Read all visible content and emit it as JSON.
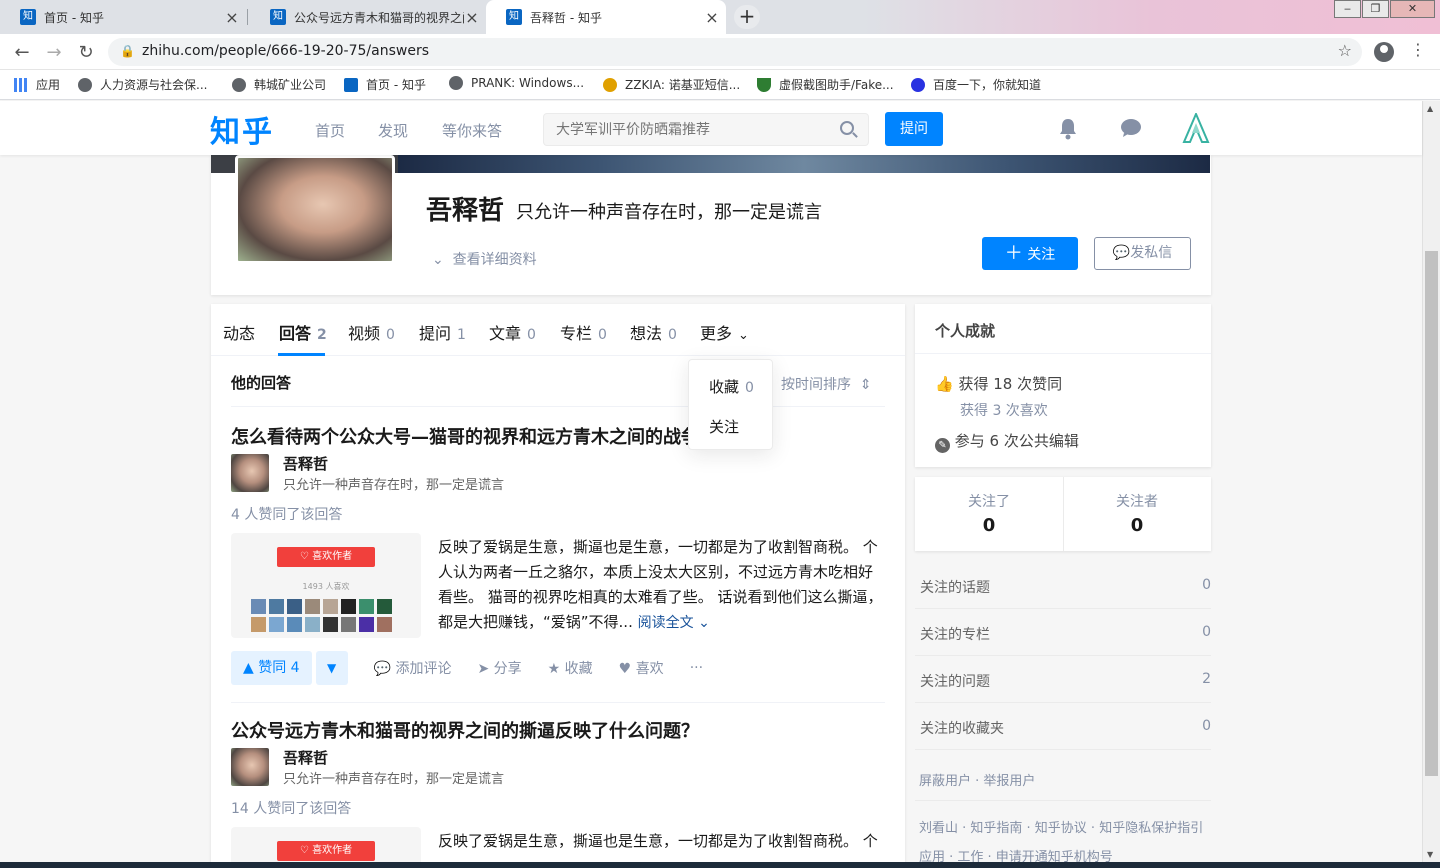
{
  "browser": {
    "tabs": [
      {
        "title": "首页 - 知乎",
        "favicon": "知"
      },
      {
        "title": "公众号远方青木和猫哥的视界之间",
        "favicon": "知"
      },
      {
        "title": "吾释哲 - 知乎",
        "favicon": "知"
      }
    ],
    "new_tab": "+",
    "close": "×",
    "url": "zhihu.com/people/666-19-20-75/answers",
    "window_controls": [
      "‒",
      "❐",
      "✕"
    ],
    "bookmarks": [
      {
        "label": "应用",
        "icon": "apps-grid-icon",
        "color": "#4285f4"
      },
      {
        "label": "人力资源与社会保...",
        "icon": "globe-icon",
        "color": "#5f6368"
      },
      {
        "label": "韩城矿业公司",
        "icon": "globe-icon",
        "color": "#5f6368"
      },
      {
        "label": "首页 - 知乎",
        "icon": "zhihu-icon",
        "color": "#0a66c2"
      },
      {
        "label": "PRANK: Windows...",
        "icon": "globe-icon",
        "color": "#5f6368"
      },
      {
        "label": "ZZKIA: 诺基亚短信...",
        "icon": "zzkia-icon",
        "color": "#e0a000"
      },
      {
        "label": "虚假截图助手/Fake...",
        "icon": "v-icon",
        "color": "#2e7d32"
      },
      {
        "label": "百度一下，你就知道",
        "icon": "baidu-icon",
        "color": "#2932e1"
      }
    ]
  },
  "header": {
    "logo": "知乎",
    "nav": [
      "首页",
      "发现",
      "等你来答"
    ],
    "search_placeholder": "大学军训平价防晒霜推荐",
    "ask_label": "提问"
  },
  "profile": {
    "name": "吾释哲",
    "headline": "只允许一种声音存在时，那一定是谎言",
    "detail_label": "查看详细资料",
    "follow_label": "关注",
    "message_label": "发私信"
  },
  "tabs": [
    {
      "label": "动态",
      "count": ""
    },
    {
      "label": "回答",
      "count": "2"
    },
    {
      "label": "视频",
      "count": "0"
    },
    {
      "label": "提问",
      "count": "1"
    },
    {
      "label": "文章",
      "count": "0"
    },
    {
      "label": "专栏",
      "count": "0"
    },
    {
      "label": "想法",
      "count": "0"
    },
    {
      "label": "更多",
      "count": ""
    }
  ],
  "more_menu": [
    {
      "label": "收藏",
      "count": "0"
    },
    {
      "label": "关注",
      "count": ""
    }
  ],
  "list": {
    "heading": "他的回答",
    "sort_label": "按时间排序"
  },
  "answers": [
    {
      "title": "怎么看待两个公众大号—猫哥的视界和远方青木之间的战争？",
      "author": "吾释哲",
      "author_headline": "只允许一种声音存在时，那一定是谎言",
      "votes_text": "4 人赞同了该回答",
      "thumb_button": "喜欢作者",
      "thumb_count": "1493 人喜欢",
      "excerpt": "反映了爱锅是生意，撕逼也是生意，一切都是为了收割智商税。 个人认为两者一丘之貉尔，本质上没太大区别，不过远方青木吃相好看些。 猫哥的视界吃相真的太难看了些。 话说看到他们这么撕逼，都是大把赚钱，“爱锅”不得...",
      "read_more": "阅读全文",
      "upvote": "▲ 赞同 4",
      "downvote": "▼",
      "actions": [
        "添加评论",
        "分享",
        "收藏",
        "喜欢",
        "···"
      ]
    },
    {
      "title": "公众号远方青木和猫哥的视界之间的撕逼反映了什么问题？",
      "author": "吾释哲",
      "author_headline": "只允许一种声音存在时，那一定是谎言",
      "votes_text": "14 人赞同了该回答",
      "thumb_button": "喜欢作者",
      "excerpt": "反映了爱锅是生意，撕逼也是生意，一切都是为了收割智商税。 个"
    }
  ],
  "achievements": {
    "heading": "个人成就",
    "upvotes": "获得 18 次赞同",
    "likes": "获得 3 次喜欢",
    "edits": "参与 6 次公共编辑"
  },
  "follow_stats": {
    "following_label": "关注了",
    "following": "0",
    "followers_label": "关注者",
    "followers": "0"
  },
  "stats": [
    {
      "label": "关注的话题",
      "value": "0"
    },
    {
      "label": "关注的专栏",
      "value": "0"
    },
    {
      "label": "关注的问题",
      "value": "2"
    },
    {
      "label": "关注的收藏夹",
      "value": "0"
    }
  ],
  "footer": {
    "report": "屏蔽用户 · 举报用户",
    "links1": "刘看山 · 知乎指南 · 知乎协议 · 知乎隐私保护指引",
    "links2": "应用 · 工作 · 申请开通知乎机构号"
  },
  "colors": {
    "brand": "#0084ff",
    "muted": "#8590a6",
    "link": "#175199"
  }
}
